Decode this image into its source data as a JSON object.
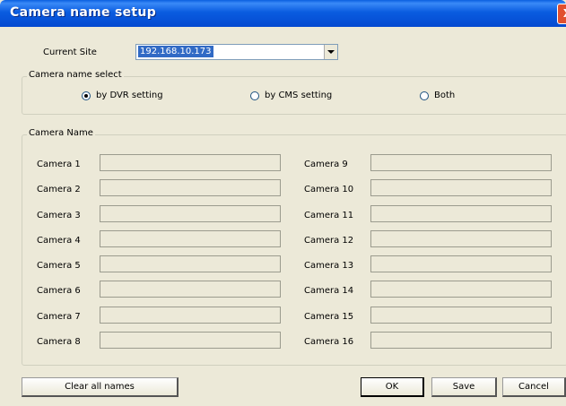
{
  "window": {
    "title": "Camera name setup",
    "close_glyph": "X"
  },
  "site": {
    "label": "Current Site",
    "value": "192.168.10.173"
  },
  "name_select": {
    "legend": "Camera name select",
    "options": [
      {
        "label": "by DVR setting",
        "checked": true
      },
      {
        "label": "by CMS setting",
        "checked": false
      },
      {
        "label": "Both",
        "checked": false
      }
    ]
  },
  "camera_names": {
    "legend": "Camera Name",
    "left": [
      {
        "label": "Camera 1",
        "value": ""
      },
      {
        "label": "Camera 2",
        "value": ""
      },
      {
        "label": "Camera 3",
        "value": ""
      },
      {
        "label": "Camera 4",
        "value": ""
      },
      {
        "label": "Camera 5",
        "value": ""
      },
      {
        "label": "Camera 6",
        "value": ""
      },
      {
        "label": "Camera 7",
        "value": ""
      },
      {
        "label": "Camera 8",
        "value": ""
      }
    ],
    "right": [
      {
        "label": "Camera 9",
        "value": ""
      },
      {
        "label": "Camera 10",
        "value": ""
      },
      {
        "label": "Camera 11",
        "value": ""
      },
      {
        "label": "Camera 12",
        "value": ""
      },
      {
        "label": "Camera 13",
        "value": ""
      },
      {
        "label": "Camera 14",
        "value": ""
      },
      {
        "label": "Camera 15",
        "value": ""
      },
      {
        "label": "Camera 16",
        "value": ""
      }
    ]
  },
  "buttons": {
    "clear": "Clear all names",
    "ok": "OK",
    "save": "Save",
    "cancel": "Cancel"
  }
}
